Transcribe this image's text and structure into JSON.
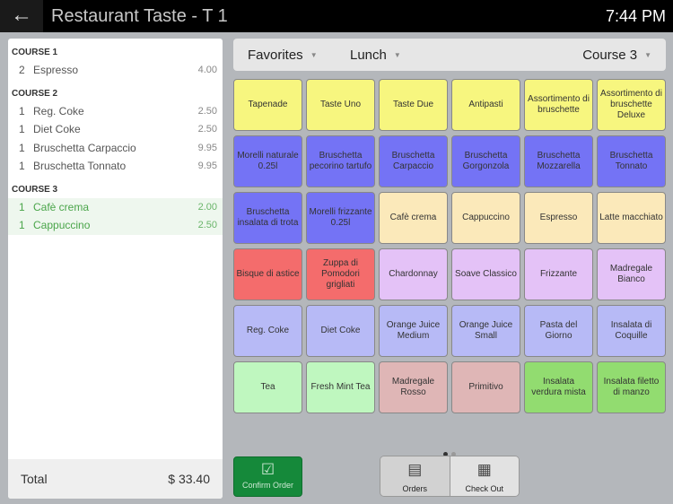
{
  "header": {
    "title": "Restaurant Taste - T 1",
    "time": "7:44 PM",
    "back_icon": "arrow-left-icon"
  },
  "order": {
    "courses": [
      {
        "label": "COURSE 1",
        "items": [
          {
            "qty": "2",
            "name": "Espresso",
            "price": "4.00"
          }
        ]
      },
      {
        "label": "COURSE 2",
        "items": [
          {
            "qty": "1",
            "name": "Reg. Coke",
            "price": "2.50"
          },
          {
            "qty": "1",
            "name": "Diet Coke",
            "price": "2.50"
          },
          {
            "qty": "1",
            "name": "Bruschetta Carpaccio",
            "price": "9.95"
          },
          {
            "qty": "1",
            "name": "Bruschetta Tonnato",
            "price": "9.95"
          }
        ]
      },
      {
        "label": "COURSE 3",
        "items": [
          {
            "qty": "1",
            "name": "Cafè crema",
            "price": "2.00"
          },
          {
            "qty": "1",
            "name": "Cappuccino",
            "price": "2.50"
          }
        ]
      }
    ],
    "total_label": "Total",
    "total_value": "$ 33.40"
  },
  "tabs": {
    "favorites": "Favorites",
    "lunch": "Lunch",
    "course": "Course 3"
  },
  "colors": {
    "yellow": "#f7f67f",
    "blue": "#7473f5",
    "cream": "#fbe9ba",
    "red": "#f46c6c",
    "lavender": "#e4c2f7",
    "periwinkle": "#b7baf6",
    "mint": "#bff7bf",
    "rose": "#dfb6b6",
    "green": "#92dc70"
  },
  "tiles": [
    [
      "Tapenade",
      "yellow"
    ],
    [
      "Taste Uno",
      "yellow"
    ],
    [
      "Taste Due",
      "yellow"
    ],
    [
      "Antipasti",
      "yellow"
    ],
    [
      "Assortimento di bruschette",
      "yellow"
    ],
    [
      "Assortimento di bruschette Deluxe",
      "yellow"
    ],
    [
      "Morelli naturale 0.25l",
      "blue"
    ],
    [
      "Bruschetta pecorino tartufo",
      "blue"
    ],
    [
      "Bruschetta Carpaccio",
      "blue"
    ],
    [
      "Bruschetta Gorgonzola",
      "blue"
    ],
    [
      "Bruschetta Mozzarella",
      "blue"
    ],
    [
      "Bruschetta Tonnato",
      "blue"
    ],
    [
      "Bruschetta insalata di trota",
      "blue"
    ],
    [
      "Morelli frizzante 0.25l",
      "blue"
    ],
    [
      "Cafè crema",
      "cream"
    ],
    [
      "Cappuccino",
      "cream"
    ],
    [
      "Espresso",
      "cream"
    ],
    [
      "Latte macchiato",
      "cream"
    ],
    [
      "Bisque di astice",
      "red"
    ],
    [
      "Zuppa di Pomodori grigliati",
      "red"
    ],
    [
      "Chardonnay",
      "lavender"
    ],
    [
      "Soave Classico",
      "lavender"
    ],
    [
      "Frizzante",
      "lavender"
    ],
    [
      "Madregale Bianco",
      "lavender"
    ],
    [
      "Reg. Coke",
      "periwinkle"
    ],
    [
      "Diet Coke",
      "periwinkle"
    ],
    [
      "Orange Juice Medium",
      "periwinkle"
    ],
    [
      "Orange Juice Small",
      "periwinkle"
    ],
    [
      "Pasta del Giorno",
      "periwinkle"
    ],
    [
      "Insalata di Coquille",
      "periwinkle"
    ],
    [
      "Tea",
      "mint"
    ],
    [
      "Fresh Mint Tea",
      "mint"
    ],
    [
      "Madregale Rosso",
      "rose"
    ],
    [
      "Primitivo",
      "rose"
    ],
    [
      "Insalata verdura mista",
      "green"
    ],
    [
      "Insalata filetto di manzo",
      "green"
    ]
  ],
  "pager": {
    "current": 1,
    "total": 2
  },
  "buttons": {
    "confirm": "Confirm Order",
    "orders": "Orders",
    "checkout": "Check Out"
  }
}
